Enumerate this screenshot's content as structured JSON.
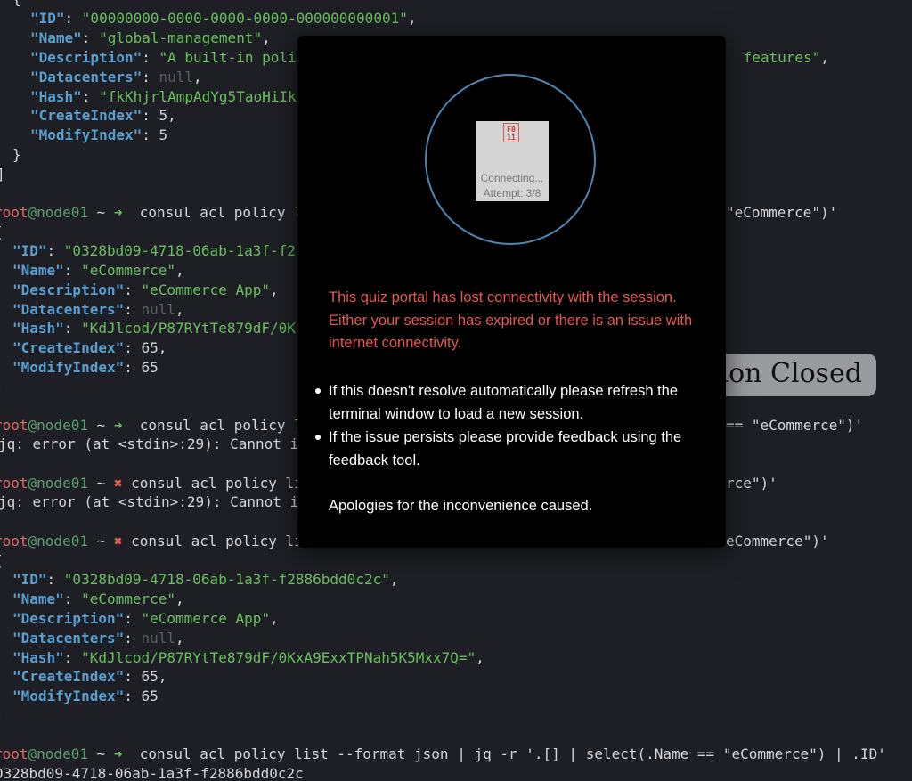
{
  "terminal": {
    "block1": {
      "open_brace": "{",
      "id_key": "\"ID\"",
      "id_val": "\"00000000-0000-0000-0000-000000000001\"",
      "name_key": "\"Name\"",
      "name_val": "\"global-management\"",
      "desc_key": "\"Description\"",
      "desc_val_start": "\"A built-in polic",
      "desc_val_end": " features\"",
      "dc_key": "\"Datacenters\"",
      "dc_val": "null",
      "hash_key": "\"Hash\"",
      "hash_val": "\"fkKhjrlAmpAdYg5TaoHiIk",
      "ci_key": "\"CreateIndex\"",
      "ci_val": "5",
      "mi_key": "\"ModifyIndex\"",
      "mi_val": "5",
      "close_brace": "}",
      "close_bracket": "]"
    },
    "prompt": {
      "user": "root",
      "host": "@node01",
      "tilde": " ~ ",
      "arrow_ok": "➜",
      "arrow_err": "✖"
    },
    "cmd1_start": "  consul acl policy l",
    "cmd1_end": "\"eCommerce\")'",
    "block2": {
      "open_bracket": "[",
      "id_key": "\"ID\"",
      "id_val": "\"0328bd09-4718-06ab-1a3f-f2",
      "name_key": "\"Name\"",
      "name_val": "\"eCommerce\"",
      "desc_key": "\"Description\"",
      "desc_val": "\"eCommerce App\"",
      "dc_key": "\"Datacenters\"",
      "dc_val": "null",
      "hash_key": "\"Hash\"",
      "hash_val": "\"KdJlcod/P87RYtTe879dF/0K",
      "ci_key": "\"CreateIndex\"",
      "ci_val": "65",
      "mi_key": "\"ModifyIndex\"",
      "mi_val": "65",
      "close_bracket": "]"
    },
    "cmd2_start": "  consul acl policy l",
    "cmd2_end": "== \"eCommerce\")'",
    "err1_start": "jq: error (at <stdin>:29): Cannot i",
    "cmd3_start": " consul acl policy li",
    "cmd3_end": "rce\")'",
    "err2_start": "jq: error (at <stdin>:29): Cannot i",
    "cmd4_start": " consul acl policy li",
    "cmd4_end": "eCommerce\")'",
    "block3": {
      "open_bracket": "[",
      "id_key": "\"ID\"",
      "id_val": "\"0328bd09-4718-06ab-1a3f-f2886bdd0c2c\"",
      "name_key": "\"Name\"",
      "name_val": "\"eCommerce\"",
      "desc_key": "\"Description\"",
      "desc_val": "\"eCommerce App\"",
      "dc_key": "\"Datacenters\"",
      "dc_val": "null",
      "hash_key": "\"Hash\"",
      "hash_val": "\"KdJlcod/P87RYtTe879dF/0KxA9ExxTPNah5K5Mxx7Q=\"",
      "ci_key": "\"CreateIndex\"",
      "ci_val": "65",
      "mi_key": "\"ModifyIndex\"",
      "mi_val": "65",
      "close_bracket": "]"
    },
    "cmd5": "  consul acl policy list --format json | jq -r '.[] | select(.Name == \"eCommerce\") | .ID'",
    "output_id": "0328bd09-4718-06ab-1a3f-f2886bdd0c2c"
  },
  "overlay_banner": "tion Closed",
  "modal": {
    "broken_image_glyph": "F0\n11",
    "connecting_text": "Connecting...",
    "attempt_text": "Attempt: 3/8",
    "error_message": "This quiz portal has lost connectivity with the session. Either your session has expired or there is an issue with internet connectivity.",
    "tips": [
      "If this doesn't resolve automatically please refresh the terminal window to load a new session.",
      "If the issue persists please provide feedback using the feedback tool."
    ],
    "apology": "Apologies for the inconvenience caused.",
    "ring_color": "#4d86b3",
    "error_color": "#e8574c"
  }
}
